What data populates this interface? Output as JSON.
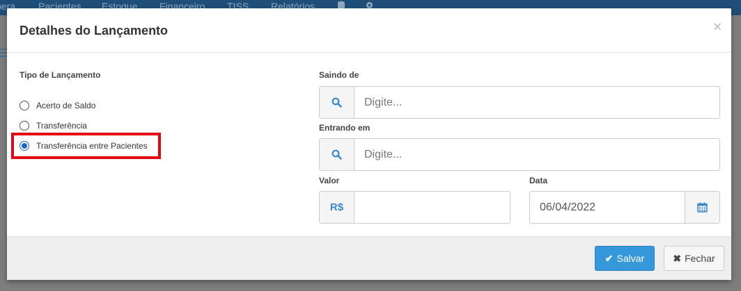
{
  "background": {
    "nav_items": [
      "pera",
      "Pacientes",
      "Estoque",
      "Financeiro",
      "TISS",
      "Relatórios"
    ],
    "icons": [
      "database-icon",
      "gear-icon"
    ]
  },
  "modal": {
    "title": "Detalhes do Lançamento",
    "close_symbol": "×",
    "tipo_label": "Tipo de Lançamento",
    "options": [
      {
        "label": "Acerto de Saldo",
        "checked": false
      },
      {
        "label": "Transferência",
        "checked": false
      },
      {
        "label": "Transferência entre Pacientes",
        "checked": true
      }
    ],
    "saindo": {
      "label": "Saindo de",
      "placeholder": "Digite..."
    },
    "entrando": {
      "label": "Entrando em",
      "placeholder": "Digite..."
    },
    "valor": {
      "label": "Valor",
      "prefix": "R$",
      "value": ""
    },
    "data": {
      "label": "Data",
      "value": "06/04/2022"
    },
    "footer": {
      "save_label": "Salvar",
      "close_label": "Fechar"
    }
  },
  "colors": {
    "accent": "#3498db",
    "highlight": "#e30613"
  }
}
